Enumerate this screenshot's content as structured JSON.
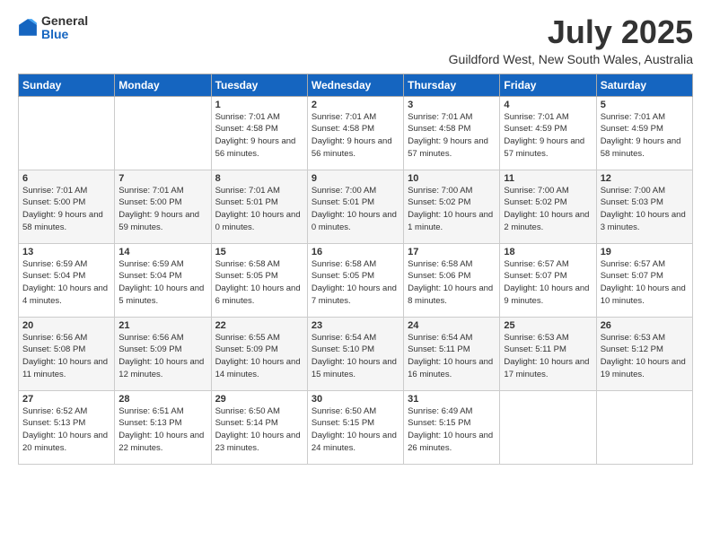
{
  "logo": {
    "general": "General",
    "blue": "Blue"
  },
  "title": "July 2025",
  "location": "Guildford West, New South Wales, Australia",
  "days_of_week": [
    "Sunday",
    "Monday",
    "Tuesday",
    "Wednesday",
    "Thursday",
    "Friday",
    "Saturday"
  ],
  "weeks": [
    [
      {
        "day": "",
        "info": ""
      },
      {
        "day": "",
        "info": ""
      },
      {
        "day": "1",
        "info": "Sunrise: 7:01 AM\nSunset: 4:58 PM\nDaylight: 9 hours\nand 56 minutes."
      },
      {
        "day": "2",
        "info": "Sunrise: 7:01 AM\nSunset: 4:58 PM\nDaylight: 9 hours\nand 56 minutes."
      },
      {
        "day": "3",
        "info": "Sunrise: 7:01 AM\nSunset: 4:58 PM\nDaylight: 9 hours\nand 57 minutes."
      },
      {
        "day": "4",
        "info": "Sunrise: 7:01 AM\nSunset: 4:59 PM\nDaylight: 9 hours\nand 57 minutes."
      },
      {
        "day": "5",
        "info": "Sunrise: 7:01 AM\nSunset: 4:59 PM\nDaylight: 9 hours\nand 58 minutes."
      }
    ],
    [
      {
        "day": "6",
        "info": "Sunrise: 7:01 AM\nSunset: 5:00 PM\nDaylight: 9 hours\nand 58 minutes."
      },
      {
        "day": "7",
        "info": "Sunrise: 7:01 AM\nSunset: 5:00 PM\nDaylight: 9 hours\nand 59 minutes."
      },
      {
        "day": "8",
        "info": "Sunrise: 7:01 AM\nSunset: 5:01 PM\nDaylight: 10 hours\nand 0 minutes."
      },
      {
        "day": "9",
        "info": "Sunrise: 7:00 AM\nSunset: 5:01 PM\nDaylight: 10 hours\nand 0 minutes."
      },
      {
        "day": "10",
        "info": "Sunrise: 7:00 AM\nSunset: 5:02 PM\nDaylight: 10 hours\nand 1 minute."
      },
      {
        "day": "11",
        "info": "Sunrise: 7:00 AM\nSunset: 5:02 PM\nDaylight: 10 hours\nand 2 minutes."
      },
      {
        "day": "12",
        "info": "Sunrise: 7:00 AM\nSunset: 5:03 PM\nDaylight: 10 hours\nand 3 minutes."
      }
    ],
    [
      {
        "day": "13",
        "info": "Sunrise: 6:59 AM\nSunset: 5:04 PM\nDaylight: 10 hours\nand 4 minutes."
      },
      {
        "day": "14",
        "info": "Sunrise: 6:59 AM\nSunset: 5:04 PM\nDaylight: 10 hours\nand 5 minutes."
      },
      {
        "day": "15",
        "info": "Sunrise: 6:58 AM\nSunset: 5:05 PM\nDaylight: 10 hours\nand 6 minutes."
      },
      {
        "day": "16",
        "info": "Sunrise: 6:58 AM\nSunset: 5:05 PM\nDaylight: 10 hours\nand 7 minutes."
      },
      {
        "day": "17",
        "info": "Sunrise: 6:58 AM\nSunset: 5:06 PM\nDaylight: 10 hours\nand 8 minutes."
      },
      {
        "day": "18",
        "info": "Sunrise: 6:57 AM\nSunset: 5:07 PM\nDaylight: 10 hours\nand 9 minutes."
      },
      {
        "day": "19",
        "info": "Sunrise: 6:57 AM\nSunset: 5:07 PM\nDaylight: 10 hours\nand 10 minutes."
      }
    ],
    [
      {
        "day": "20",
        "info": "Sunrise: 6:56 AM\nSunset: 5:08 PM\nDaylight: 10 hours\nand 11 minutes."
      },
      {
        "day": "21",
        "info": "Sunrise: 6:56 AM\nSunset: 5:09 PM\nDaylight: 10 hours\nand 12 minutes."
      },
      {
        "day": "22",
        "info": "Sunrise: 6:55 AM\nSunset: 5:09 PM\nDaylight: 10 hours\nand 14 minutes."
      },
      {
        "day": "23",
        "info": "Sunrise: 6:54 AM\nSunset: 5:10 PM\nDaylight: 10 hours\nand 15 minutes."
      },
      {
        "day": "24",
        "info": "Sunrise: 6:54 AM\nSunset: 5:11 PM\nDaylight: 10 hours\nand 16 minutes."
      },
      {
        "day": "25",
        "info": "Sunrise: 6:53 AM\nSunset: 5:11 PM\nDaylight: 10 hours\nand 17 minutes."
      },
      {
        "day": "26",
        "info": "Sunrise: 6:53 AM\nSunset: 5:12 PM\nDaylight: 10 hours\nand 19 minutes."
      }
    ],
    [
      {
        "day": "27",
        "info": "Sunrise: 6:52 AM\nSunset: 5:13 PM\nDaylight: 10 hours\nand 20 minutes."
      },
      {
        "day": "28",
        "info": "Sunrise: 6:51 AM\nSunset: 5:13 PM\nDaylight: 10 hours\nand 22 minutes."
      },
      {
        "day": "29",
        "info": "Sunrise: 6:50 AM\nSunset: 5:14 PM\nDaylight: 10 hours\nand 23 minutes."
      },
      {
        "day": "30",
        "info": "Sunrise: 6:50 AM\nSunset: 5:15 PM\nDaylight: 10 hours\nand 24 minutes."
      },
      {
        "day": "31",
        "info": "Sunrise: 6:49 AM\nSunset: 5:15 PM\nDaylight: 10 hours\nand 26 minutes."
      },
      {
        "day": "",
        "info": ""
      },
      {
        "day": "",
        "info": ""
      }
    ]
  ]
}
